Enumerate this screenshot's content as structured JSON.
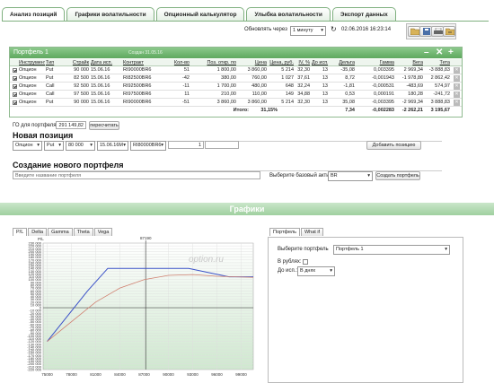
{
  "tabs": [
    "Анализ позиций",
    "Графики волатильности",
    "Опционный калькулятор",
    "Улыбка волатильности",
    "Экспорт данных"
  ],
  "toolbar": {
    "refresh_label": "Обновлять через",
    "refresh_value": "1 минуту",
    "datetime": "02.06.2016 16:23:14"
  },
  "portfolio": {
    "name": "Портфель 1",
    "subtitle": "Создан 31.05.16",
    "columns": [
      "Инструмент",
      "Тип",
      "Страйк",
      "Дата исп.",
      "Контракт",
      "Кол-во",
      "Поз. откр. по",
      "Цена",
      "Цена, руб.",
      "IV, %",
      "До исп.",
      "Дельта",
      "Гамма",
      "Вега",
      "Тета"
    ],
    "rows": [
      [
        "Опцион",
        "Put",
        "90 000",
        "15.06.16",
        "RI90000BR6",
        "51",
        "1 800,00",
        "3 860,00",
        "5 214",
        "32,30",
        "13",
        "-35,08",
        "0,003395",
        "2 969,34",
        "-3 888,83"
      ],
      [
        "Опцион",
        "Put",
        "82 500",
        "15.06.16",
        "RI82500BR6",
        "-42",
        "380,00",
        "760,00",
        "1 027",
        "37,61",
        "13",
        "8,72",
        "-0,001943",
        "-1 978,80",
        "2 862,42"
      ],
      [
        "Опцион",
        "Call",
        "92 500",
        "15.06.16",
        "RI92500BR6",
        "-11",
        "1 700,00",
        "480,00",
        "648",
        "32,24",
        "13",
        "-1,81",
        "-0,000531",
        "-483,69",
        "574,97"
      ],
      [
        "Опцион",
        "Call",
        "97 500",
        "15.06.16",
        "RI97500BR6",
        "11",
        "210,00",
        "110,00",
        "149",
        "34,88",
        "13",
        "0,53",
        "0,000191",
        "180,28",
        "-241,72"
      ],
      [
        "Опцион",
        "Put",
        "90 000",
        "15.06.16",
        "RI90000BR6",
        "-51",
        "3 860,00",
        "3 860,00",
        "5 214",
        "32,30",
        "13",
        "35,08",
        "-0,003395",
        "-2 969,34",
        "3 888,83"
      ]
    ],
    "total_label": "Итого:",
    "total": {
      "pct": "31,15%",
      "delta": "7,34",
      "gamma": "-0,002283",
      "vega": "-2 262,21",
      "theta": "3 195,67"
    },
    "go_label": "ГО для портфеля:",
    "go_value": "291 149,82",
    "recalc_label": "пересчитать"
  },
  "new_position": {
    "title": "Новая позиция",
    "fields": [
      "Опцион",
      "Put",
      "80 000",
      "15.06.16M",
      "RI80000BR6",
      "1"
    ],
    "add_label": "Добавить позицию"
  },
  "new_portfolio": {
    "title": "Создание нового портфеля",
    "name_placeholder": "Введите название портфеля",
    "base_label": "Выберите базовый актив",
    "base_value": "BR",
    "create_label": "Создать портфель"
  },
  "graphs_title": "Графики",
  "chart_tabs": [
    "P/L",
    "Delta",
    "Gamma",
    "Theta",
    "Vega"
  ],
  "watermark": "option.ru",
  "right_tabs": [
    "Портфель",
    "What if"
  ],
  "right": {
    "portfolio_label": "Выберите портфель",
    "portfolio_value": "Портфель 1",
    "rub_label": "В рублях:",
    "days_label": "До исп.:",
    "days_value": "В днях"
  },
  "chart_data": {
    "type": "line",
    "ylabel": "P/L",
    "x_ticks": [
      75000,
      78000,
      81000,
      84000,
      87000,
      90000,
      93000,
      96000,
      99000
    ],
    "marker": 87190,
    "marker_label": "87190",
    "ylim": [
      -220000,
      230000
    ],
    "y_ticks": [
      230000,
      220000,
      210000,
      200000,
      190000,
      180000,
      170000,
      160000,
      150000,
      140000,
      130000,
      120000,
      110000,
      100000,
      90000,
      80000,
      70000,
      60000,
      50000,
      40000,
      30000,
      20000,
      10000,
      0,
      -10000,
      -20000,
      -30000,
      -40000,
      -50000,
      -60000,
      -70000,
      -80000,
      -90000,
      -100000,
      -110000,
      -120000,
      -130000,
      -140000,
      -150000,
      -160000,
      -170000,
      -180000,
      -190000,
      -200000,
      -210000,
      -220000
    ],
    "series": [
      {
        "color": "#3a50c8",
        "x": [
          75000,
          80000,
          82500,
          92500,
          97500,
          100500
        ],
        "values": [
          -120000,
          60000,
          140000,
          140000,
          110000,
          110000
        ]
      },
      {
        "color": "#d08070",
        "x": [
          75000,
          78000,
          81000,
          84000,
          87000,
          90000,
          93000,
          96000,
          100500
        ],
        "values": [
          -120000,
          -50000,
          20000,
          70000,
          100000,
          115000,
          118000,
          112000,
          108000
        ]
      }
    ]
  }
}
